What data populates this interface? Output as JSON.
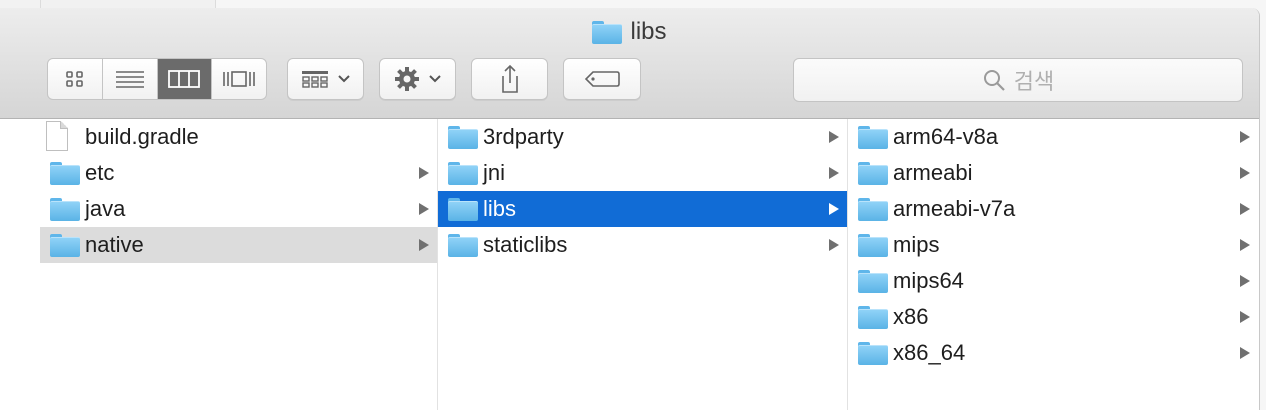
{
  "window": {
    "title": "libs",
    "title_icon": "folder-icon"
  },
  "toolbar": {
    "view_buttons": [
      {
        "name": "icon-view",
        "icon": "grid-icon",
        "active": false
      },
      {
        "name": "list-view",
        "icon": "list-icon",
        "active": false
      },
      {
        "name": "column-view",
        "icon": "columns-icon",
        "active": true
      },
      {
        "name": "gallery-view",
        "icon": "cover-flow-icon",
        "active": false
      }
    ],
    "arrange_icon": "arrange-icon",
    "action_icon": "gear-icon",
    "share_icon": "share-icon",
    "tag_icon": "tag-icon",
    "search_placeholder": "검색"
  },
  "columns": [
    {
      "items": [
        {
          "name": "build.gradle",
          "type": "file",
          "has_children": false,
          "selected": ""
        },
        {
          "name": "etc",
          "type": "folder",
          "has_children": true,
          "selected": ""
        },
        {
          "name": "java",
          "type": "folder",
          "has_children": true,
          "selected": ""
        },
        {
          "name": "native",
          "type": "folder",
          "has_children": true,
          "selected": "inactive"
        }
      ]
    },
    {
      "items": [
        {
          "name": "3rdparty",
          "type": "folder",
          "has_children": true,
          "selected": ""
        },
        {
          "name": "jni",
          "type": "folder",
          "has_children": true,
          "selected": ""
        },
        {
          "name": "libs",
          "type": "folder",
          "has_children": true,
          "selected": "active"
        },
        {
          "name": "staticlibs",
          "type": "folder",
          "has_children": true,
          "selected": ""
        }
      ]
    },
    {
      "items": [
        {
          "name": "arm64-v8a",
          "type": "folder",
          "has_children": true,
          "selected": ""
        },
        {
          "name": "armeabi",
          "type": "folder",
          "has_children": true,
          "selected": ""
        },
        {
          "name": "armeabi-v7a",
          "type": "folder",
          "has_children": true,
          "selected": ""
        },
        {
          "name": "mips",
          "type": "folder",
          "has_children": true,
          "selected": ""
        },
        {
          "name": "mips64",
          "type": "folder",
          "has_children": true,
          "selected": ""
        },
        {
          "name": "x86",
          "type": "folder",
          "has_children": true,
          "selected": ""
        },
        {
          "name": "x86_64",
          "type": "folder",
          "has_children": true,
          "selected": ""
        }
      ]
    }
  ],
  "colors": {
    "selection_active": "#116cd6",
    "selection_inactive": "#dcdcdc",
    "folder": "#5ab3e6"
  }
}
